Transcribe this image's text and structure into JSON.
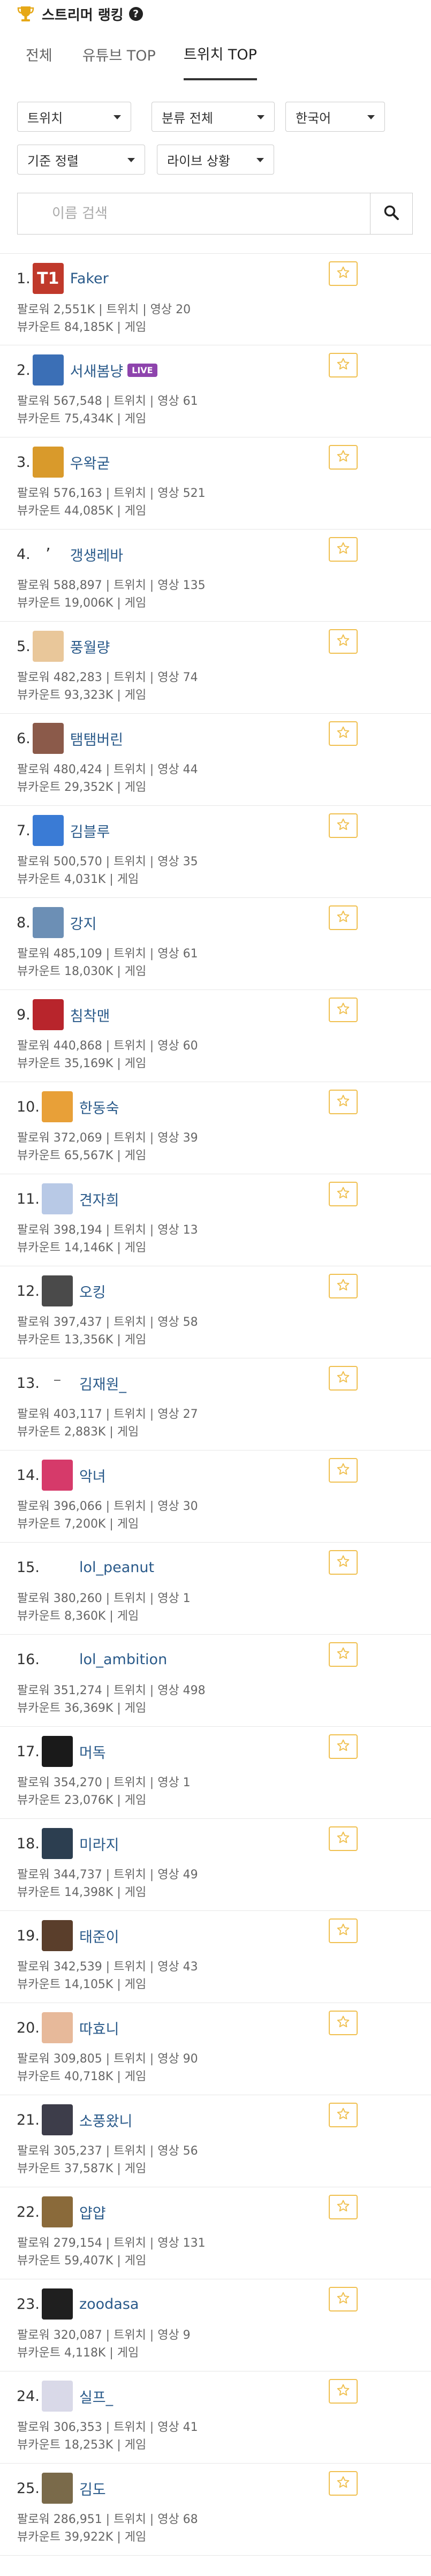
{
  "header": {
    "title": "스트리머 랭킹"
  },
  "tabs": [
    {
      "label": "전체"
    },
    {
      "label": "유튜브 TOP"
    },
    {
      "label": "트위치 TOP"
    }
  ],
  "filters": {
    "platform": "트위치",
    "category": "분류 전체",
    "language": "한국어",
    "sort": "기준 정렬",
    "live_status": "라이브 상황"
  },
  "search": {
    "placeholder": "이름 검색"
  },
  "labels": {
    "live": "LIVE"
  },
  "streamers": [
    {
      "rank": "1.",
      "name": "Faker",
      "avatar_color": "#c0392b",
      "avatar_text": "T1",
      "line1": "팔로워 2,551K | 트위치 | 영상 20",
      "line2": "뷰카운트 84,185K | 게임"
    },
    {
      "rank": "2.",
      "name": "서새봄냥",
      "avatar_color": "#3b6fb6",
      "avatar_text": "",
      "live": true,
      "line1": "팔로워 567,548 | 트위치 | 영상 61",
      "line2": "뷰카운트 75,434K | 게임"
    },
    {
      "rank": "3.",
      "name": "우왁굳",
      "avatar_color": "#d99a2b",
      "avatar_text": "",
      "line1": "팔로워 576,163 | 트위치 | 영상 521",
      "line2": "뷰카운트 44,085K | 게임"
    },
    {
      "rank": "4.",
      "name": "갱생레바",
      "avatar_color": "#ffffff",
      "avatar_text": "ʼ",
      "line1": "팔로워 588,897 | 트위치 | 영상 135",
      "line2": "뷰카운트 19,006K | 게임"
    },
    {
      "rank": "5.",
      "name": "풍월량",
      "avatar_color": "#e9c79a",
      "avatar_text": "",
      "line1": "팔로워 482,283 | 트위치 | 영상 74",
      "line2": "뷰카운트 93,323K | 게임"
    },
    {
      "rank": "6.",
      "name": "탬탬버린",
      "avatar_color": "#8b5a4a",
      "avatar_text": "",
      "line1": "팔로워 480,424 | 트위치 | 영상 44",
      "line2": "뷰카운트 29,352K | 게임"
    },
    {
      "rank": "7.",
      "name": "김블루",
      "avatar_color": "#3a7bd5",
      "avatar_text": "",
      "line1": "팔로워 500,570 | 트위치 | 영상 35",
      "line2": "뷰카운트 4,031K | 게임"
    },
    {
      "rank": "8.",
      "name": "강지",
      "avatar_color": "#6c8fb5",
      "avatar_text": "",
      "line1": "팔로워 485,109 | 트위치 | 영상 61",
      "line2": "뷰카운트 18,030K | 게임"
    },
    {
      "rank": "9.",
      "name": "침착맨",
      "avatar_color": "#b8252c",
      "avatar_text": "",
      "line1": "팔로워 440,868 | 트위치 | 영상 60",
      "line2": "뷰카운트 35,169K | 게임"
    },
    {
      "rank": "10.",
      "name": "한동숙",
      "avatar_color": "#e8a038",
      "avatar_text": "",
      "line1": "팔로워 372,069 | 트위치 | 영상 39",
      "line2": "뷰카운트 65,567K | 게임"
    },
    {
      "rank": "11.",
      "name": "견자희",
      "avatar_color": "#b8c9e6",
      "avatar_text": "",
      "line1": "팔로워 398,194 | 트위치 | 영상 13",
      "line2": "뷰카운트 14,146K | 게임"
    },
    {
      "rank": "12.",
      "name": "오킹",
      "avatar_color": "#4a4a4a",
      "avatar_text": "",
      "line1": "팔로워 397,437 | 트위치 | 영상 58",
      "line2": "뷰카운트 13,356K | 게임"
    },
    {
      "rank": "13.",
      "name": "김재원_",
      "avatar_color": "#ffffff",
      "avatar_text": "⁻",
      "line1": "팔로워 403,117 | 트위치 | 영상 27",
      "line2": "뷰카운트 2,883K | 게임"
    },
    {
      "rank": "14.",
      "name": "악녀",
      "avatar_color": "#d63a6a",
      "avatar_text": "",
      "line1": "팔로워 396,066 | 트위치 | 영상 30",
      "line2": "뷰카운트 7,200K | 게임"
    },
    {
      "rank": "15.",
      "name": "lol_peanut",
      "avatar_color": "#ffffff",
      "avatar_text": "",
      "line1": "팔로워 380,260 | 트위치 | 영상 1",
      "line2": "뷰카운트 8,360K | 게임"
    },
    {
      "rank": "16.",
      "name": "lol_ambition",
      "avatar_color": "#ffffff",
      "avatar_text": "",
      "line1": "팔로워 351,274 | 트위치 | 영상 498",
      "line2": "뷰카운트 36,369K | 게임"
    },
    {
      "rank": "17.",
      "name": "머독",
      "avatar_color": "#1a1a1a",
      "avatar_text": "",
      "line1": "팔로워 354,270 | 트위치 | 영상 1",
      "line2": "뷰카운트 23,076K | 게임"
    },
    {
      "rank": "18.",
      "name": "미라지",
      "avatar_color": "#2c3e50",
      "avatar_text": "",
      "line1": "팔로워 344,737 | 트위치 | 영상 49",
      "line2": "뷰카운트 14,398K | 게임"
    },
    {
      "rank": "19.",
      "name": "태준이",
      "avatar_color": "#5a3e2b",
      "avatar_text": "",
      "line1": "팔로워 342,539 | 트위치 | 영상 43",
      "line2": "뷰카운트 14,105K | 게임"
    },
    {
      "rank": "20.",
      "name": "따효니",
      "avatar_color": "#e7b99a",
      "avatar_text": "",
      "line1": "팔로워 309,805 | 트위치 | 영상 90",
      "line2": "뷰카운트 40,718K | 게임"
    },
    {
      "rank": "21.",
      "name": "소풍왔니",
      "avatar_color": "#3d3d4a",
      "avatar_text": "",
      "line1": "팔로워 305,237 | 트위치 | 영상 56",
      "line2": "뷰카운트 37,587K | 게임"
    },
    {
      "rank": "22.",
      "name": "얍얍",
      "avatar_color": "#8a6a3a",
      "avatar_text": "",
      "line1": "팔로워 279,154 | 트위치 | 영상 131",
      "line2": "뷰카운트 59,407K | 게임"
    },
    {
      "rank": "23.",
      "name": "zoodasa",
      "avatar_color": "#1f1f1f",
      "avatar_text": "",
      "line1": "팔로워 320,087 | 트위치 | 영상 9",
      "line2": "뷰카운트 4,118K | 게임"
    },
    {
      "rank": "24.",
      "name": "실프_",
      "avatar_color": "#d9d9e8",
      "avatar_text": "",
      "line1": "팔로워 306,353 | 트위치 | 영상 41",
      "line2": "뷰카운트 18,253K | 게임"
    },
    {
      "rank": "25.",
      "name": "김도",
      "avatar_color": "#7a6a4a",
      "avatar_text": "",
      "line1": "팔로워 286,951 | 트위치 | 영상 68",
      "line2": "뷰카운트 39,922K | 게임"
    }
  ],
  "colors": {
    "accent": "#f0c050",
    "name_link": "#2a5a8a",
    "trophy": "#e6a817",
    "live_badge": "#8e44ad"
  }
}
